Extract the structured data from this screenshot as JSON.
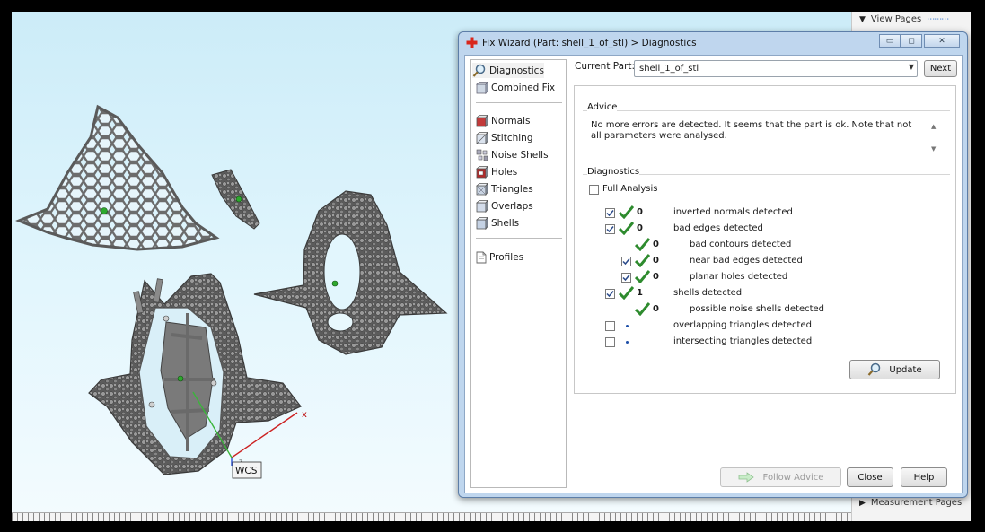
{
  "right_panel": {
    "view_pages": "View Pages",
    "measurement_pages": "Measurement Pages"
  },
  "viewport": {
    "wcs_label": "WCS",
    "axis_x": "x",
    "axis_z": "z"
  },
  "dialog": {
    "title": "Fix Wizard (Part: shell_1_of_stl) > Diagnostics",
    "nav": {
      "top": [
        "Diagnostics",
        "Combined Fix"
      ],
      "tools": [
        "Normals",
        "Stitching",
        "Noise Shells",
        "Holes",
        "Triangles",
        "Overlaps",
        "Shells"
      ],
      "bottom": [
        "Profiles"
      ]
    },
    "current_part_label": "Current Part:",
    "current_part_value": "shell_1_of_stl",
    "next_button": "Next",
    "advice": {
      "title": "Advice",
      "text": "No more errors are detected. It seems that the part is ok. Note that not all parameters were analysed."
    },
    "diagnostics": {
      "title": "Diagnostics",
      "full_analysis_label": "Full Analysis",
      "full_analysis_checked": false,
      "rows": [
        {
          "label": "inverted normals detected",
          "count": "0",
          "checked": true,
          "status": "ok"
        },
        {
          "label": "bad edges detected",
          "count": "0",
          "checked": true,
          "status": "ok"
        },
        {
          "label": "bad contours detected",
          "count": "0",
          "checked": null,
          "status": "ok"
        },
        {
          "label": "near bad edges detected",
          "count": "0",
          "checked": true,
          "status": "ok"
        },
        {
          "label": "planar holes detected",
          "count": "0",
          "checked": true,
          "status": "ok"
        },
        {
          "label": "shells detected",
          "count": "1",
          "checked": true,
          "status": "ok"
        },
        {
          "label": "possible noise shells detected",
          "count": "0",
          "checked": null,
          "status": "ok"
        },
        {
          "label": "overlapping triangles detected",
          "count": "",
          "checked": false,
          "status": "pending"
        },
        {
          "label": "intersecting triangles detected",
          "count": "",
          "checked": false,
          "status": "pending"
        }
      ],
      "update_button": "Update"
    },
    "footer": {
      "follow_advice": "Follow Advice",
      "close": "Close",
      "help": "Help"
    },
    "colors": {
      "accent_green": "#2e8b2e",
      "title_bar": "#bfd6ee",
      "dot_blue": "#1d4fa8"
    }
  }
}
